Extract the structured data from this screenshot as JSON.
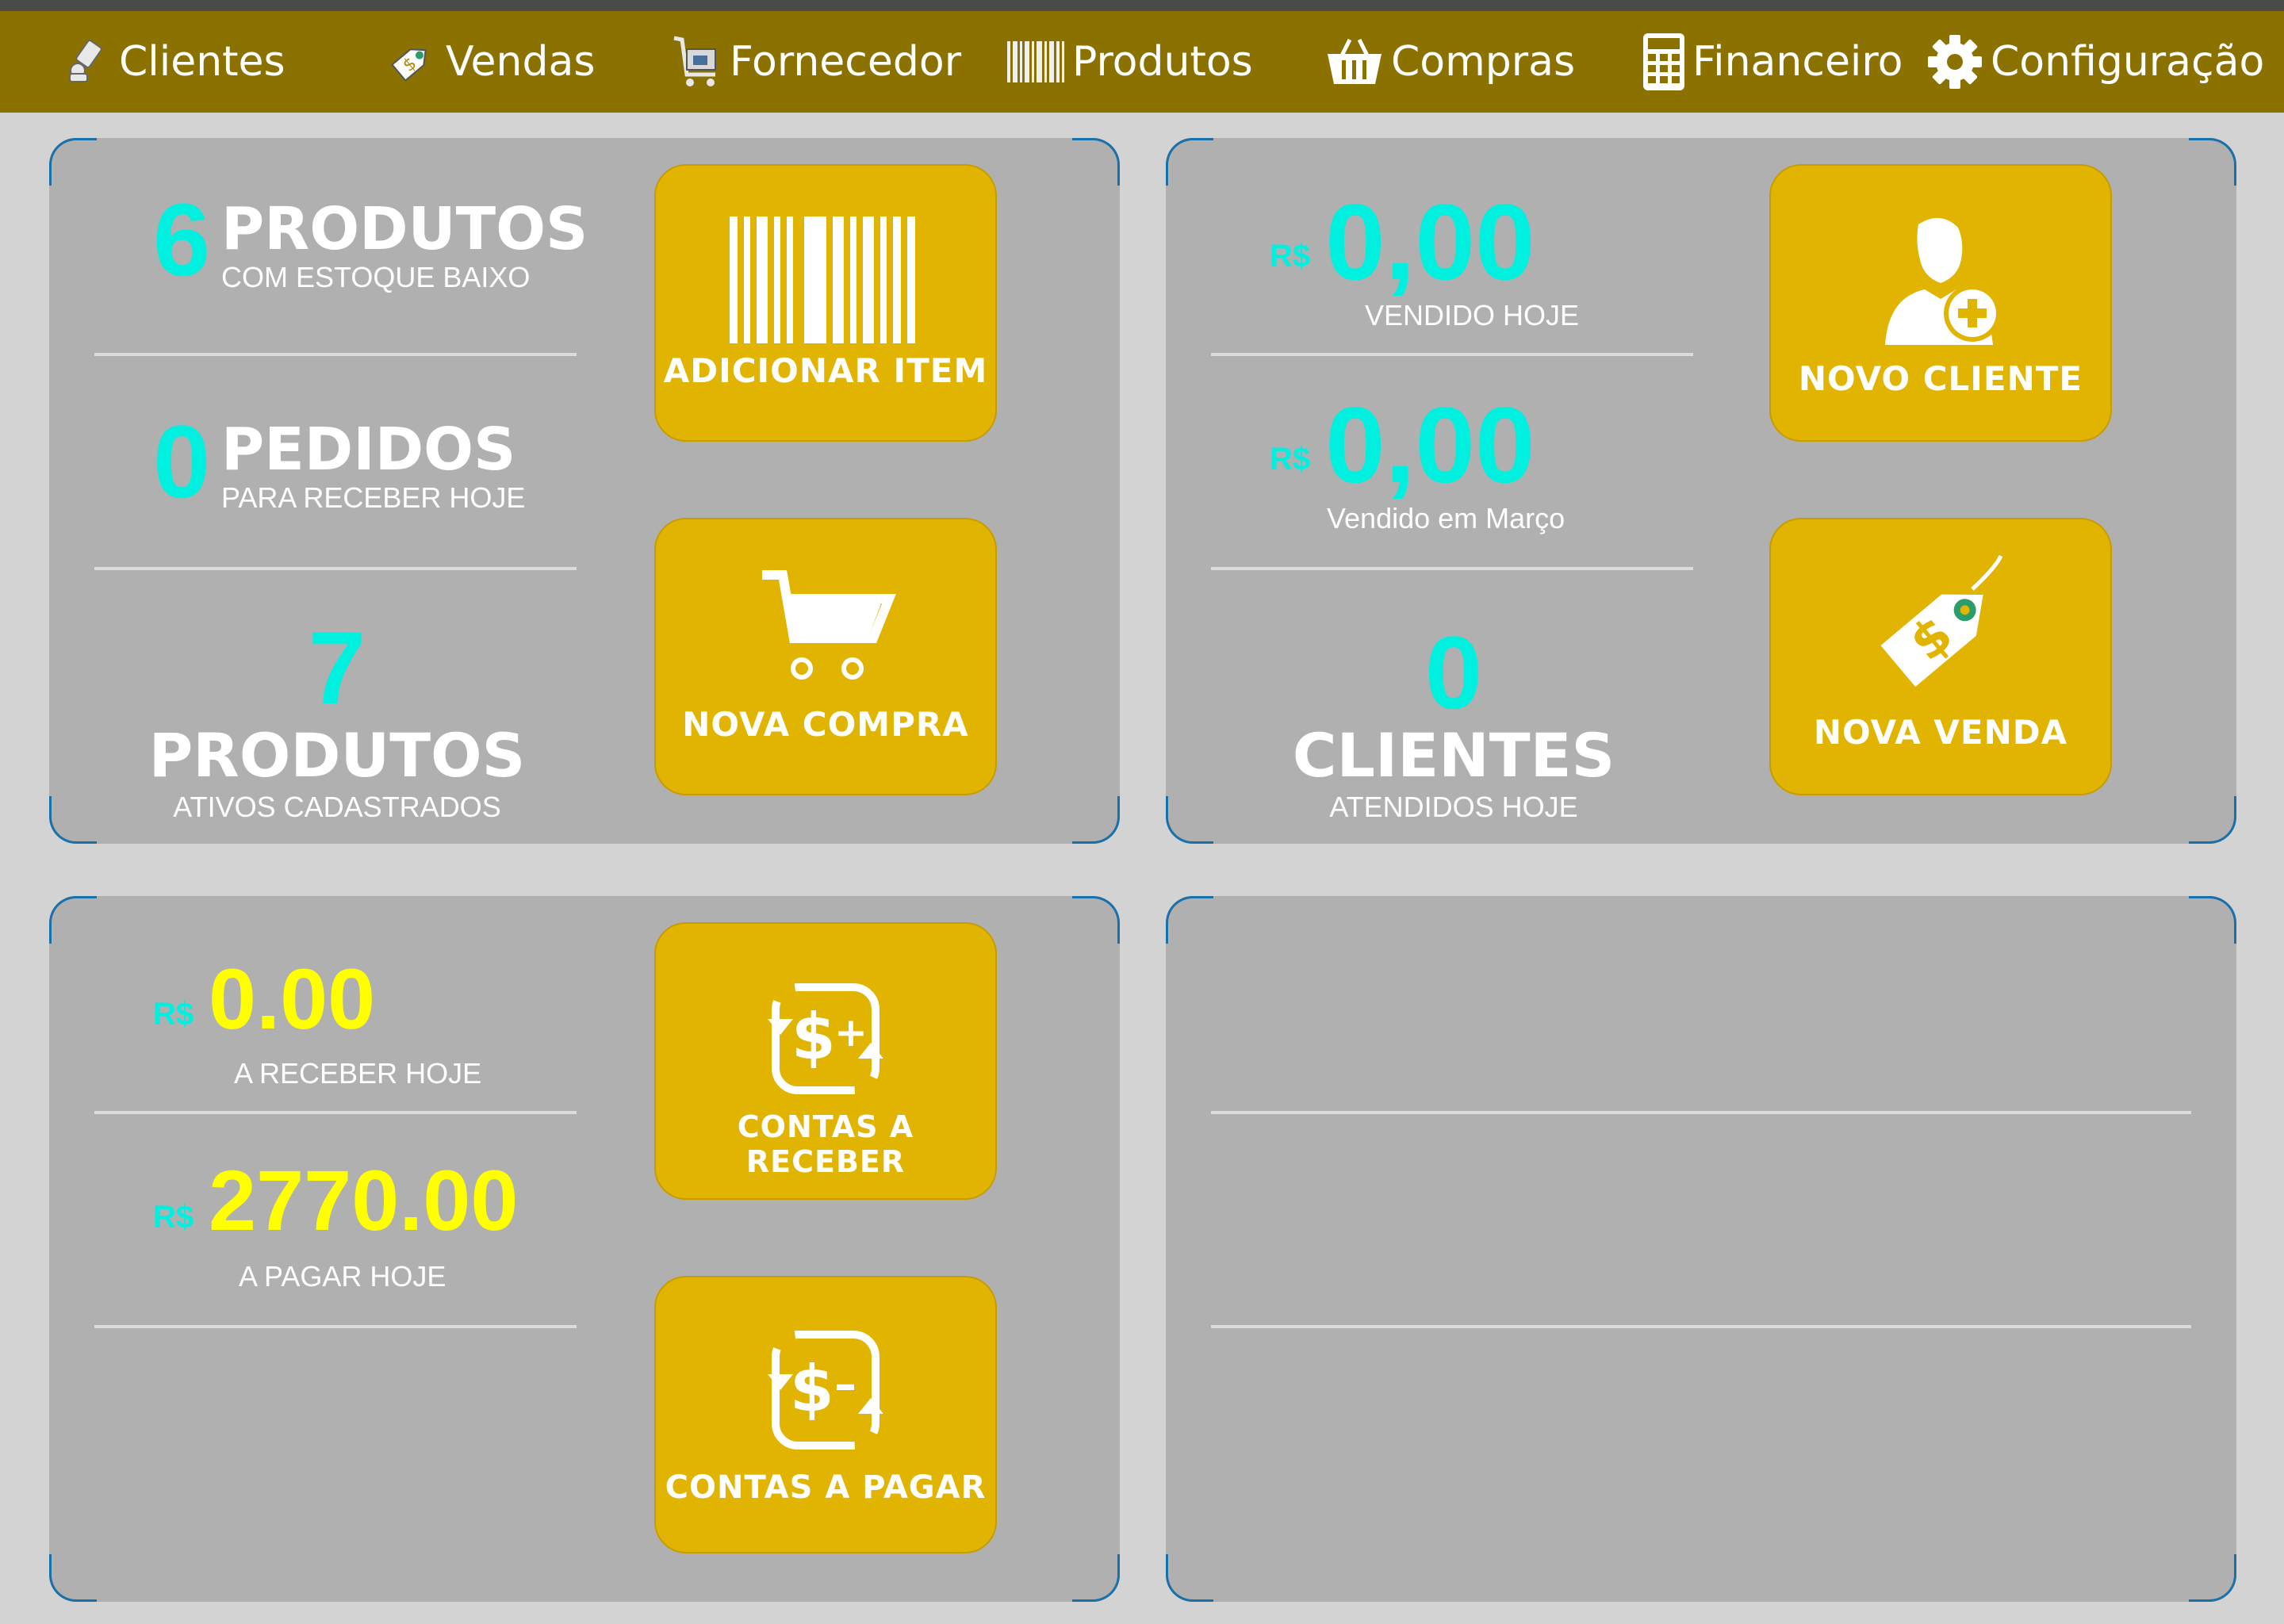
{
  "nav": {
    "clientes": "Clientes",
    "vendas": "Vendas",
    "fornecedor": "Fornecedor",
    "produtos": "Produtos",
    "compras": "Compras",
    "financeiro": "Financeiro",
    "configuracao": "Configuração"
  },
  "produtos_panel": {
    "low_stock_count": "6",
    "low_stock_word": "PRODUTOS",
    "low_stock_caption": "COM ESTOQUE BAIXO",
    "orders_count": "0",
    "orders_word": "PEDIDOS",
    "orders_caption": "PARA RECEBER HOJE",
    "active_count": "7",
    "active_word": "PRODUTOS",
    "active_caption": "ATIVOS CADASTRADOS",
    "add_item_label": "ADICIONAR ITEM",
    "new_purchase_label": "NOVA COMPRA"
  },
  "vendas_panel": {
    "currency_symbol": "R$",
    "sold_today_value": "0,00",
    "sold_today_caption": "VENDIDO HOJE",
    "sold_month_value": "0,00",
    "sold_month_caption": "Vendido em Março",
    "clients_count": "0",
    "clients_word": "CLIENTES",
    "clients_caption": "ATENDIDOS HOJE",
    "new_client_label": "NOVO CLIENTE",
    "new_sale_label": "NOVA VENDA"
  },
  "financeiro_panel": {
    "currency_symbol": "R$",
    "receivable_value": "0.00",
    "receivable_caption": "A RECEBER HOJE",
    "payable_value": "2770.00",
    "payable_caption": "A PAGAR HOJE",
    "receivables_label": "CONTAS A RECEBER",
    "payables_label": "CONTAS A PAGAR"
  },
  "colors": {
    "navbar": "#8b7100",
    "tile": "#e0b400",
    "panel": "#b0b0b0",
    "accent_cyan": "#00f0e0",
    "accent_yellow": "#ffff00",
    "corner_blue": "#1a70a8"
  },
  "icons": {
    "clientes": "wrench-user-icon",
    "vendas": "price-tag-icon",
    "fornecedor": "supplier-cart-icon",
    "produtos": "barcode-icon",
    "compras": "basket-icon",
    "financeiro": "calculator-icon",
    "configuracao": "gear-icon"
  }
}
